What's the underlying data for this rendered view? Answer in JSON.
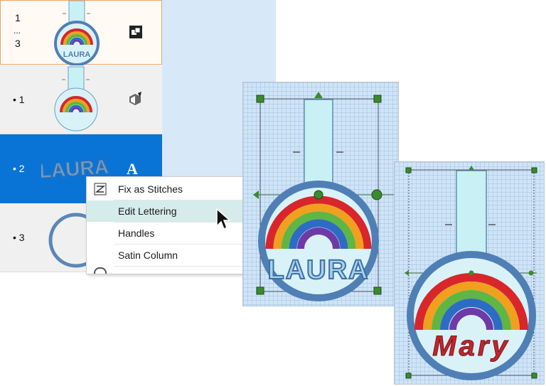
{
  "object_list": {
    "rows": [
      {
        "label_top": "1",
        "label_dots": "...",
        "label_bottom": "3",
        "thumb_text": "LAURA",
        "icon": "group-icon"
      },
      {
        "label": "• 1",
        "icon": "stitch-object-icon"
      },
      {
        "label": "• 2",
        "thumb_text": "LAURA",
        "icon": "lettering-icon",
        "icon_glyph": "A"
      },
      {
        "label": "• 3"
      }
    ]
  },
  "context_menu": {
    "items": [
      {
        "label": "Fix as Stitches",
        "icon": "fix-stitches-icon"
      },
      {
        "label": "Edit Lettering"
      },
      {
        "label": "Handles"
      },
      {
        "label": "Satin Column"
      }
    ]
  },
  "previews": {
    "before_text": "LAURA",
    "after_text": "Mary"
  },
  "colors": {
    "selection": "#0a74d6",
    "menu_hover": "#d6ecea",
    "canvas": "#cfe4f7",
    "handle": "#3a8a2e",
    "ring": "#5b86b8",
    "lettering_red": "#c0262c"
  }
}
